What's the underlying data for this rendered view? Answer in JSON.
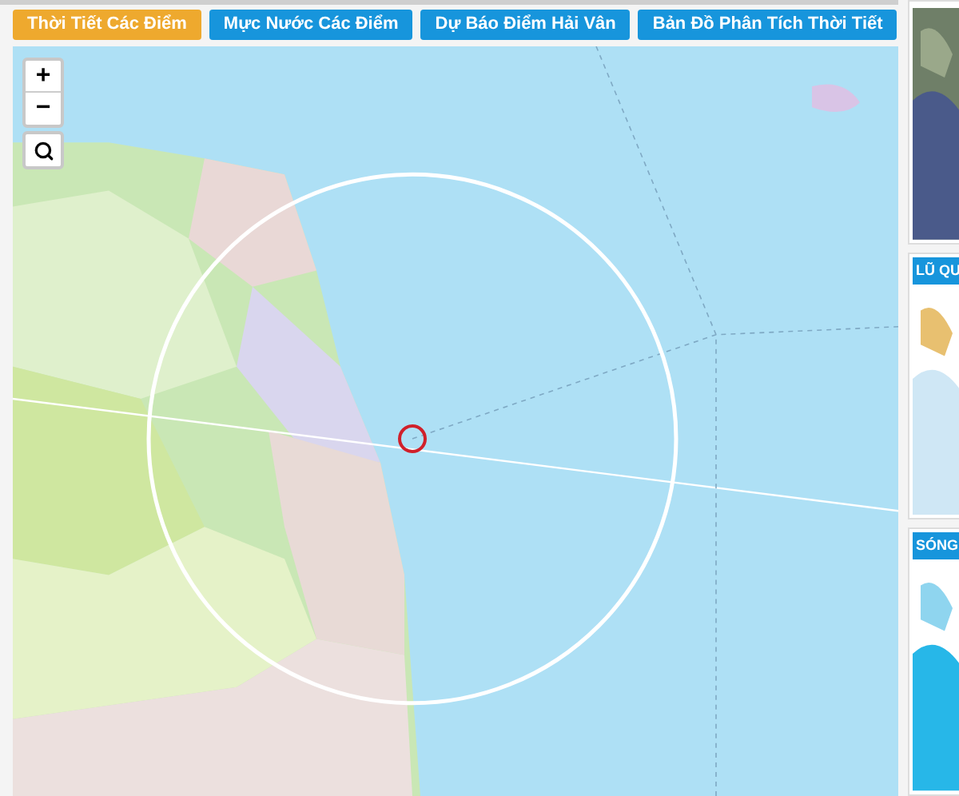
{
  "tabs": [
    {
      "label": "Thời Tiết Các Điểm",
      "selected": true
    },
    {
      "label": "Mực Nước Các Điểm",
      "selected": false
    },
    {
      "label": "Dự Báo Điểm Hải Vân",
      "selected": false
    },
    {
      "label": "Bản Đồ Phân Tích Thời Tiết",
      "selected": false
    }
  ],
  "map": {
    "kind": "picture",
    "zoom_in": "+",
    "zoom_out": "−"
  },
  "side_cards": [
    {
      "kind": "picture"
    },
    {
      "title": "LŨ QU",
      "kind": "picture"
    },
    {
      "title": "SÓNG",
      "kind": "picture"
    }
  ]
}
